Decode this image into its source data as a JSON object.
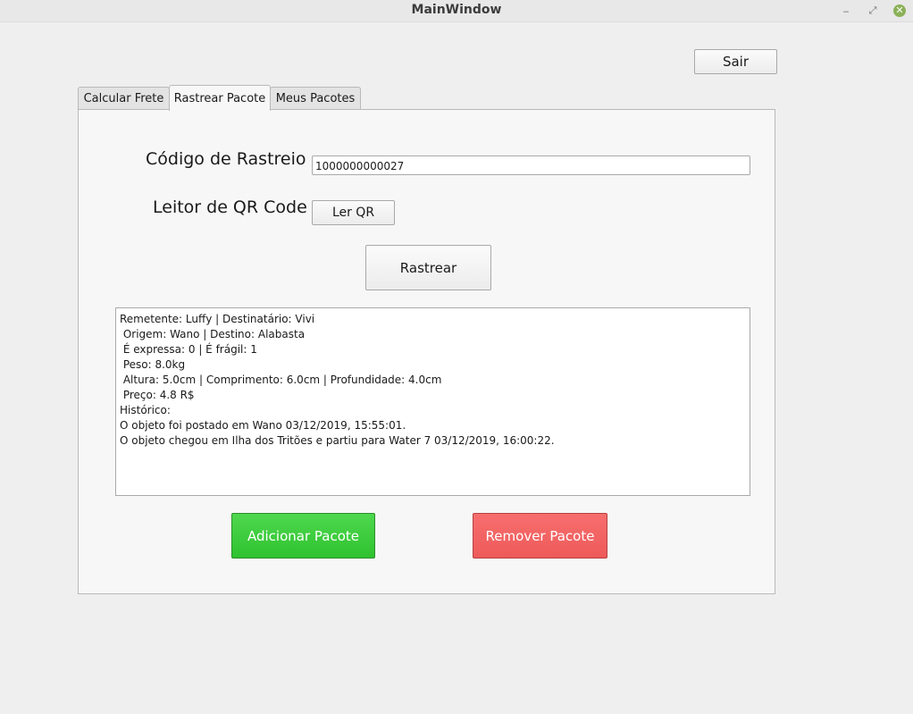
{
  "window": {
    "title": "MainWindow",
    "controls": {
      "minimize": "‒",
      "maximize": "⤢",
      "close": "✕"
    }
  },
  "top": {
    "exit_label": "Sair"
  },
  "tabs": [
    {
      "label": "Calcular Frete",
      "active": false
    },
    {
      "label": "Rastrear Pacote",
      "active": true
    },
    {
      "label": "Meus Pacotes",
      "active": false
    }
  ],
  "track": {
    "code_label": "Código de Rastreio",
    "code_value": "1000000000027",
    "qr_label": "Leitor de QR Code",
    "qr_button": "Ler QR",
    "track_button": "Rastrear",
    "result_lines": [
      "Remetente: Luffy | Destinatário: Vivi",
      " Origem: Wano | Destino: Alabasta",
      " É expressa: 0 | É frágil: 1",
      " Peso: 8.0kg",
      " Altura: 5.0cm | Comprimento: 6.0cm | Profundidade: 4.0cm",
      " Preço: 4.8 R$",
      "Histórico:",
      "O objeto foi postado em Wano 03/12/2019, 15:55:01.",
      "O objeto chegou em Ilha dos Tritões e partiu para Water 7 03/12/2019, 16:00:22."
    ],
    "add_button": "Adicionar Pacote",
    "remove_button": "Remover Pacote"
  },
  "colors": {
    "add_button": "#36c936",
    "remove_button": "#f26464",
    "close_control": "#8bb158"
  }
}
